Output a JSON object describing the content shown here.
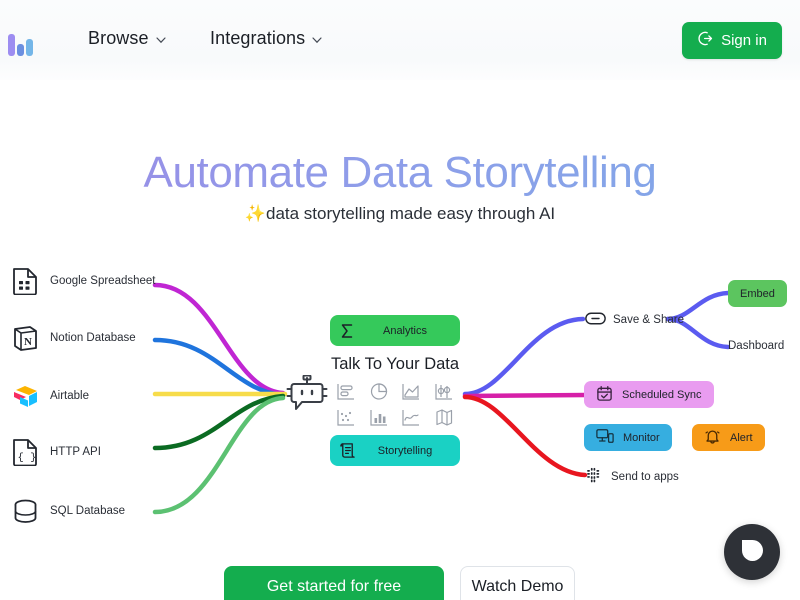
{
  "header": {
    "logo_name": "bar-chart-logo",
    "nav": [
      {
        "label": "Browse",
        "icon": "chevron-down-icon"
      },
      {
        "label": "Integrations",
        "icon": "chevron-down-icon"
      }
    ],
    "signin_label": "Sign in",
    "signin_icon": "sign-in-arrow-icon",
    "signin_color": "#14ad4e"
  },
  "hero": {
    "title": "Automate Data Storytelling",
    "subtitle": "data storytelling made easy through AI",
    "sparkle": "✨",
    "gradient_from": "#9b8ae6",
    "gradient_to": "#7fa9e8"
  },
  "sources": [
    {
      "label": "Google Spreadsheet",
      "icon": "google-spreadsheet-icon",
      "line_color": "#c026d3"
    },
    {
      "label": "Notion Database",
      "icon": "notion-icon",
      "line_color": "#1f74dd"
    },
    {
      "label": "Airtable",
      "icon": "airtable-icon",
      "line_color": "#f7dc4a"
    },
    {
      "label": "HTTP API",
      "icon": "http-api-icon",
      "line_color": "#0b6b22"
    },
    {
      "label": "SQL Database",
      "icon": "sql-database-icon",
      "line_color": "#5cc172"
    }
  ],
  "center": {
    "bot_icon": "chat-bot-icon",
    "analytics_label": "Analytics",
    "analytics_icon": "sigma-icon",
    "analytics_color": "#35c95b",
    "heading": "Talk To Your Data",
    "storytelling_label": "Storytelling",
    "storytelling_icon": "scroll-icon",
    "storytelling_color": "#1ad1c4",
    "chart_icons": [
      "horizontal-bar-chart-icon",
      "pie-chart-icon",
      "area-chart-icon",
      "candlestick-chart-icon",
      "scatter-plot-icon",
      "bar-chart-icon",
      "line-chart-icon",
      "map-chart-icon"
    ]
  },
  "outputs": {
    "save_share": {
      "label": "Save & Share",
      "icon": "link-icon",
      "line_color": "#5b5bf0"
    },
    "embed": {
      "label": "Embed",
      "color": "#5cc55f"
    },
    "dashboard": {
      "label": "Dashboard"
    },
    "scheduled_sync": {
      "label": "Scheduled Sync",
      "icon": "calendar-check-icon",
      "color": "#e99cf0",
      "line_color": "#d61fa8"
    },
    "monitor": {
      "label": "Monitor",
      "icon": "monitor-device-icon",
      "color": "#36aee0"
    },
    "alert": {
      "label": "Alert",
      "icon": "bell-icon",
      "color": "#f79b18"
    },
    "send_to_apps": {
      "label": "Send to apps",
      "icon": "slack-icon",
      "line_color": "#e8161f"
    }
  },
  "cta": {
    "primary_label": "Get started for free",
    "secondary_label": "Watch Demo"
  },
  "chat_widget": {
    "icon": "chat-bubble-icon",
    "color": "#2e3137"
  }
}
